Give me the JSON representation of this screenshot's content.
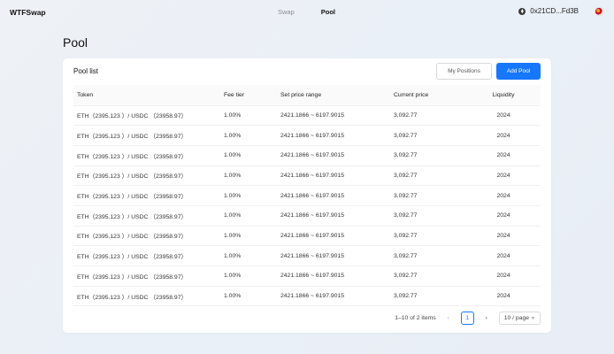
{
  "header": {
    "logo": "WTFSwap",
    "tabs": [
      {
        "label": "Swap",
        "active": false
      },
      {
        "label": "Pool",
        "active": true
      }
    ],
    "wallet_address": "0x21CD...Fd3B",
    "wallet_icon": "eth-icon",
    "avatar_icon": "avatar-icon"
  },
  "page": {
    "title": "Pool"
  },
  "card": {
    "title": "Pool list",
    "my_positions_label": "My Positions",
    "add_pool_label": "Add Pool"
  },
  "table": {
    "columns": [
      "Token",
      "Fee tier",
      "Set price range",
      "Current price",
      "Liquidity"
    ],
    "rows": [
      {
        "token": "ETH（2395.123 ）/ USDC （23958.97）",
        "fee": "1.00%",
        "range": "2421.1866 ~ 6197.9015",
        "price": "3,092.77",
        "liquidity": "2024"
      },
      {
        "token": "ETH（2395.123 ）/ USDC （23958.97）",
        "fee": "1.00%",
        "range": "2421.1866 ~ 6197.9015",
        "price": "3,092.77",
        "liquidity": "2024"
      },
      {
        "token": "ETH（2395.123 ）/ USDC （23958.97）",
        "fee": "1.00%",
        "range": "2421.1866 ~ 6197.9015",
        "price": "3,092.77",
        "liquidity": "2024"
      },
      {
        "token": "ETH（2395.123 ）/ USDC （23958.97）",
        "fee": "1.00%",
        "range": "2421.1866 ~ 6197.9015",
        "price": "3,092.77",
        "liquidity": "2024"
      },
      {
        "token": "ETH（2395.123 ）/ USDC （23958.97）",
        "fee": "1.00%",
        "range": "2421.1866 ~ 6197.9015",
        "price": "3,092.77",
        "liquidity": "2024"
      },
      {
        "token": "ETH（2395.123 ）/ USDC （23958.97）",
        "fee": "1.00%",
        "range": "2421.1866 ~ 6197.9015",
        "price": "3,092.77",
        "liquidity": "2024"
      },
      {
        "token": "ETH（2395.123 ）/ USDC （23958.97）",
        "fee": "1.00%",
        "range": "2421.1866 ~ 6197.9015",
        "price": "3,092.77",
        "liquidity": "2024"
      },
      {
        "token": "ETH（2395.123 ）/ USDC （23958.97）",
        "fee": "1.00%",
        "range": "2421.1866 ~ 6197.9015",
        "price": "3,092.77",
        "liquidity": "2024"
      },
      {
        "token": "ETH（2395.123 ）/ USDC （23958.97）",
        "fee": "1.00%",
        "range": "2421.1866 ~ 6197.9015",
        "price": "3,092.77",
        "liquidity": "2024"
      },
      {
        "token": "ETH（2395.123 ）/ USDC （23958.97）",
        "fee": "1.00%",
        "range": "2421.1866 ~ 6197.9015",
        "price": "3,092.77",
        "liquidity": "2024"
      }
    ]
  },
  "pagination": {
    "summary": "1–10 of 2 items",
    "prev": "‹",
    "current_page": "1",
    "next": "›",
    "page_size": "10 / page"
  },
  "colors": {
    "accent": "#1677ff"
  }
}
